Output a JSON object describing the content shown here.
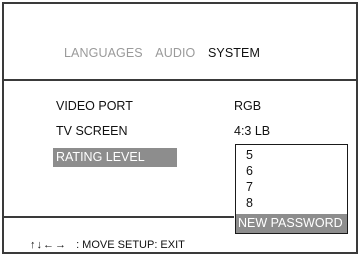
{
  "tabs": [
    {
      "label": "LANGUAGES",
      "active": false
    },
    {
      "label": "AUDIO",
      "active": false
    },
    {
      "label": "SYSTEM",
      "active": true
    }
  ],
  "settings": [
    {
      "label": "VIDEO PORT",
      "value": "RGB"
    },
    {
      "label": "TV SCREEN",
      "value": "4:3 LB"
    },
    {
      "label": "RATING LEVEL"
    }
  ],
  "dropdown": {
    "options": [
      "5",
      "6",
      "7",
      "8"
    ],
    "selected": "NEW PASSWORD"
  },
  "footer": {
    "arrows": "↑↓←→",
    "move": ": MOVE",
    "setup": "SETUP: EXIT"
  },
  "colors": {
    "highlight": "#8d8d8d",
    "border": "#3a3a3a",
    "inactive_tab": "#9a9a9a"
  }
}
